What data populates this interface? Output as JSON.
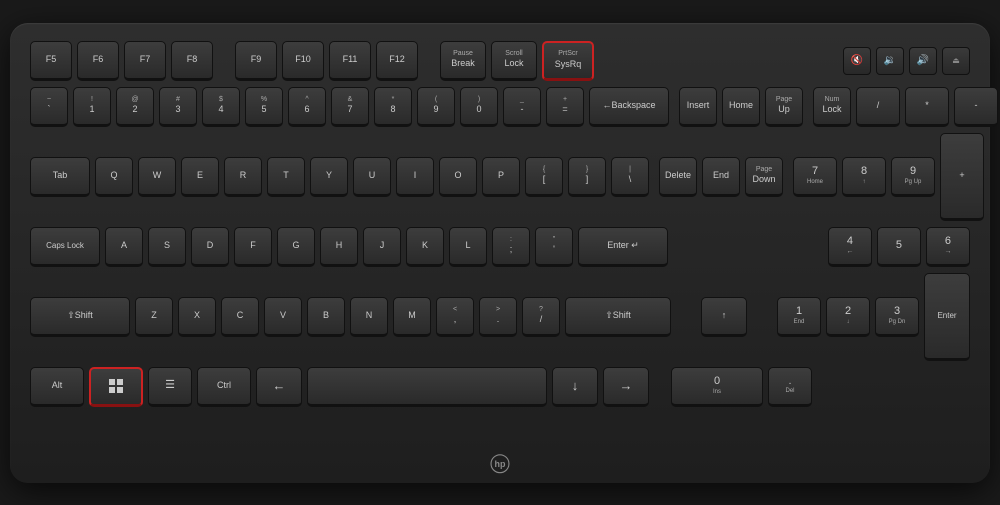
{
  "keyboard": {
    "brand": "HP",
    "rows": {
      "function_row": {
        "keys": [
          "F5",
          "F6",
          "F7",
          "F8",
          "F9",
          "F10",
          "F11",
          "F12"
        ]
      },
      "special_keys": {
        "pause_break": [
          "Pause",
          "Break"
        ],
        "scroll_lock": [
          "Scroll",
          "Lock"
        ],
        "print_screen": [
          "PrtScr",
          "SysRq"
        ]
      }
    },
    "highlighted_keys": {
      "print_screen": "PrtScr/SysRq",
      "windows": "Windows"
    }
  },
  "keys": {
    "f5": "F5",
    "f6": "F6",
    "f7": "F7",
    "f8": "F8",
    "f9": "F9",
    "f10": "F10",
    "f11": "F11",
    "f12": "F12",
    "pause_top": "Pause",
    "pause_bot": "Break",
    "scroll_top": "Scroll",
    "scroll_bot": "Lock",
    "prtscr_top": "PrtScr",
    "prtscr_bot": "SysRq"
  }
}
